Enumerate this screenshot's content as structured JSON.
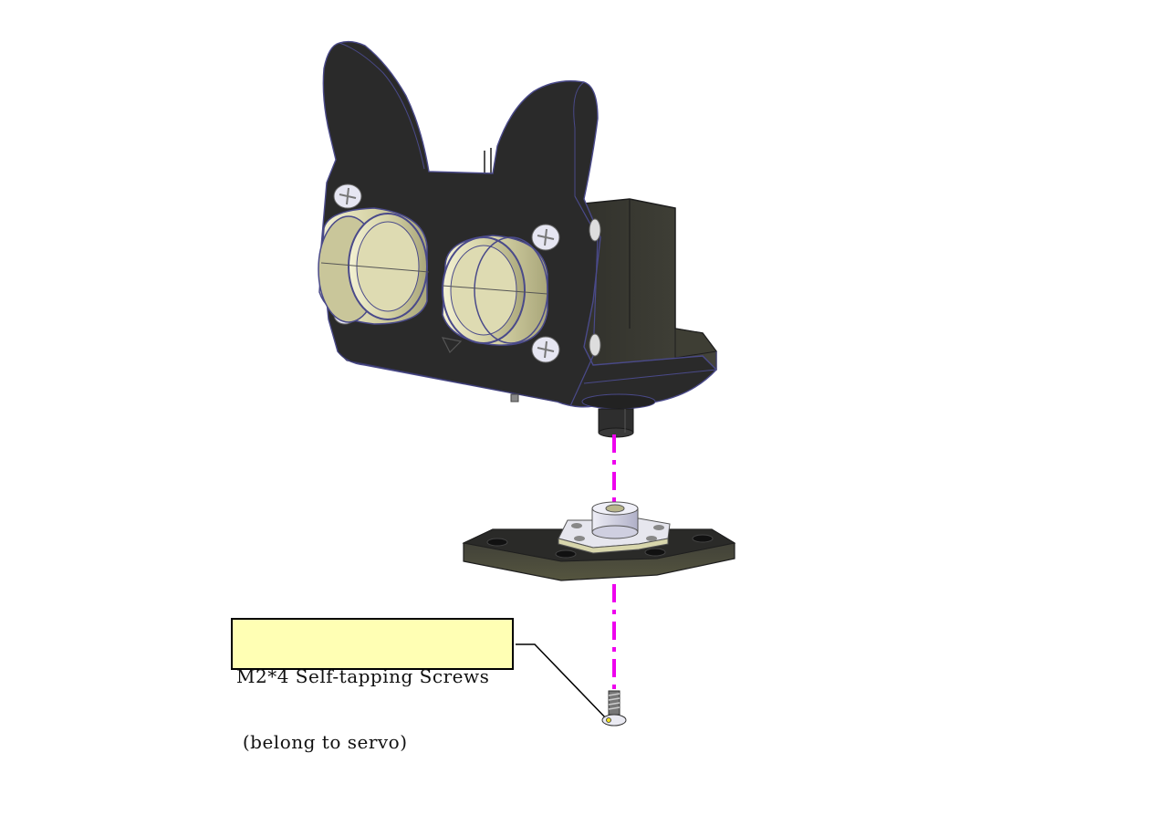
{
  "callout": {
    "line1": "M2*4 Self-tapping Screws",
    "line2": " (belong to servo)"
  },
  "colors": {
    "part_dark": "#2b2b2b",
    "part_edge": "#4a4a8a",
    "sensor_ring": "#d8d6ac",
    "screw_white": "#e8e8f4",
    "axis_line": "#ee00ee",
    "callout_fill": "#ffffb4"
  },
  "icons": [
    "ultrasonic-sensor-bracket",
    "servo-horn-plate",
    "self-tapping-screw",
    "assembly-axis-line",
    "leader-line"
  ]
}
